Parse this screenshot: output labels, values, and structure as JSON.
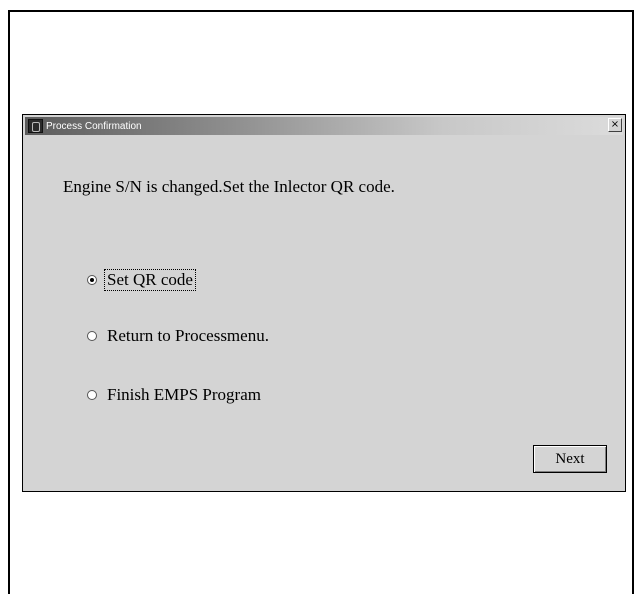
{
  "window": {
    "title": "Process Confirmation",
    "close_glyph": "×"
  },
  "message": "Engine S/N is changed.Set the Inlector QR code.",
  "options": [
    {
      "label": "Set QR code",
      "selected": true
    },
    {
      "label": "Return to Processmenu.",
      "selected": false
    },
    {
      "label": "Finish EMPS Program",
      "selected": false
    }
  ],
  "buttons": {
    "next_label": "Next"
  },
  "icons": {
    "app": "app-icon",
    "close": "close-icon"
  }
}
